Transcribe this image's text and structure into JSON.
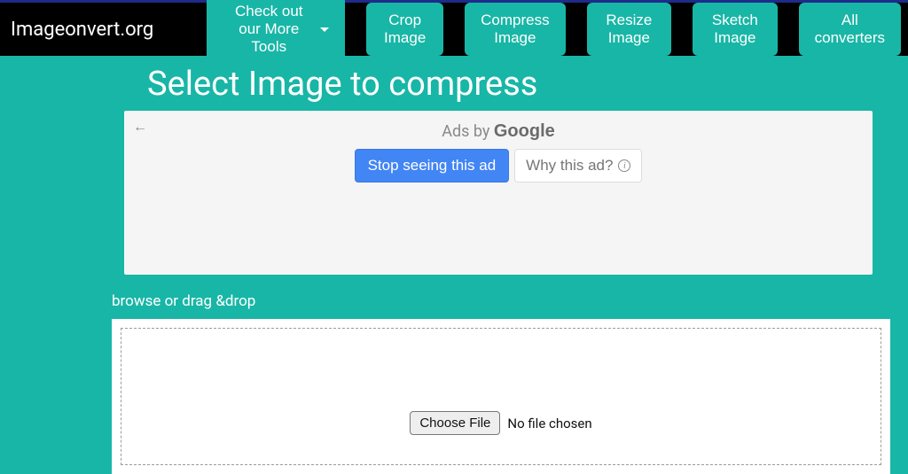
{
  "brand": "Imageonvert.org",
  "nav": {
    "more_tools": "Check out our More Tools",
    "crop": "Crop Image",
    "compress": "Compress Image",
    "resize": "Resize Image",
    "sketch": "Sketch Image",
    "all": "All converters"
  },
  "title": "Select Image to compress",
  "ad": {
    "ads_by_prefix": "Ads by ",
    "ads_by_brand": "Google",
    "stop": "Stop seeing this ad",
    "why": "Why this ad?"
  },
  "upload": {
    "hint": "browse or drag &drop",
    "choose": "Choose File",
    "status": "No file chosen"
  }
}
